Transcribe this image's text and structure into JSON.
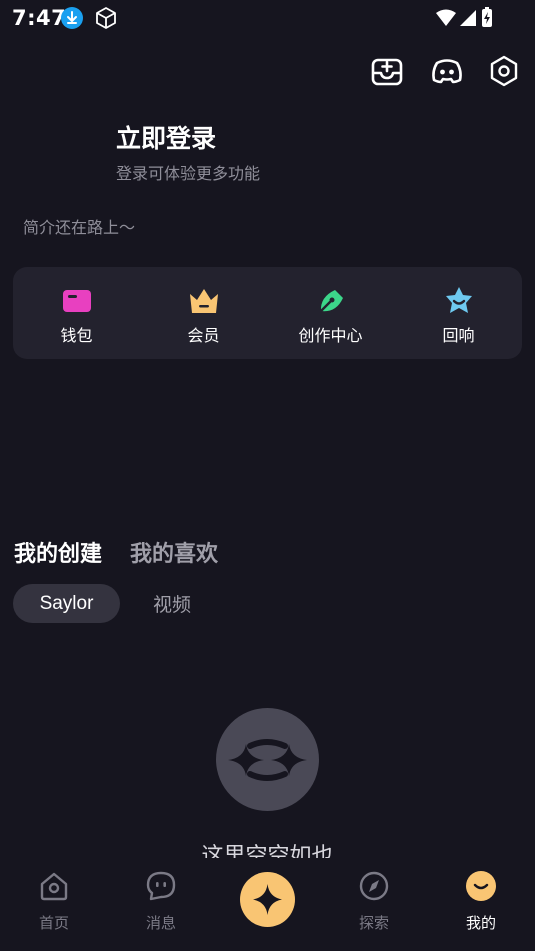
{
  "status_bar": {
    "time": "7:47"
  },
  "profile": {
    "login_title": "立即登录",
    "login_subtitle": "登录可体验更多功能",
    "bio": "简介还在路上～"
  },
  "quick_actions": [
    {
      "label": "钱包",
      "icon": "wallet-icon",
      "color": "#e840c0"
    },
    {
      "label": "会员",
      "icon": "crown-icon",
      "color": "#f9c573"
    },
    {
      "label": "创作中心",
      "icon": "pen-icon",
      "color": "#3cd68a"
    },
    {
      "label": "回响",
      "icon": "star-badge-icon",
      "color": "#6ec9f0"
    }
  ],
  "content_tabs": {
    "my_creations": "我的创建",
    "my_likes": "我的喜欢",
    "filter_active": "Saylor",
    "filter_other": "视频"
  },
  "empty_state": {
    "text": "这里空空如也"
  },
  "bottom_nav": {
    "home": "首页",
    "messages": "消息",
    "explore": "探索",
    "me": "我的"
  },
  "colors": {
    "background": "#16151f",
    "panel": "#23222e",
    "accent": "#f9c573",
    "muted_text": "#8f8e99"
  }
}
